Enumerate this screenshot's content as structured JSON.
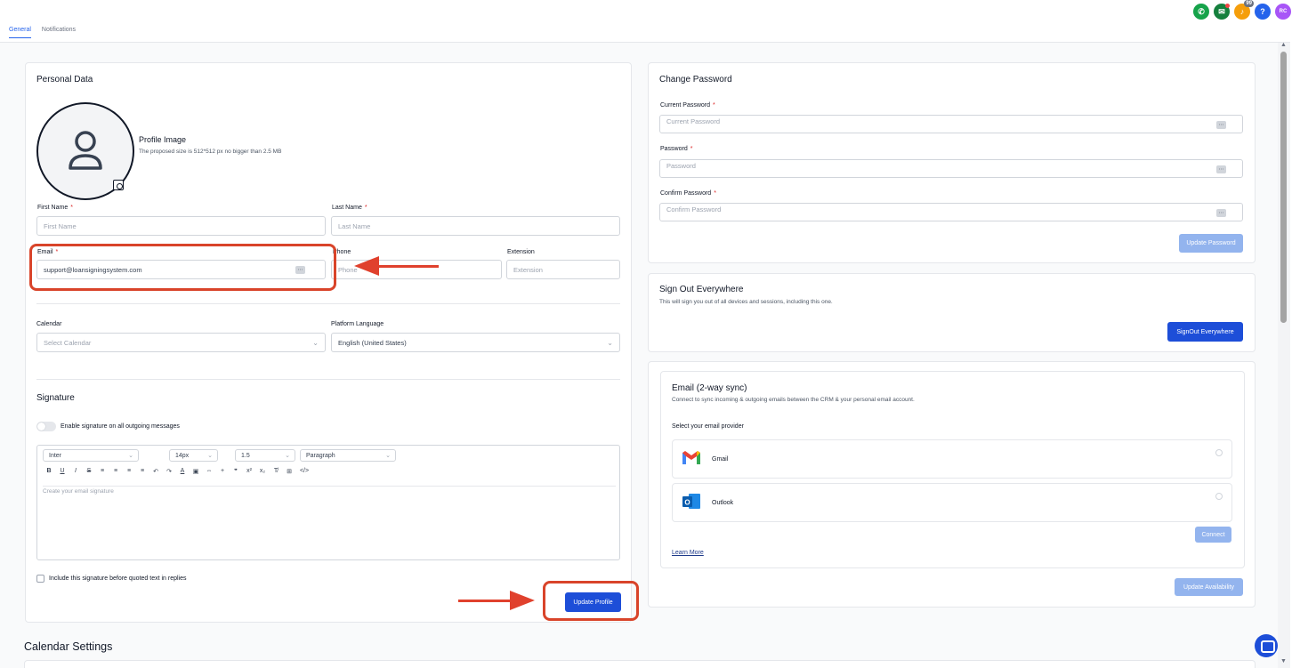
{
  "topbar": {
    "icons": [
      {
        "name": "phone-icon",
        "color": "#16a34a",
        "glyph": "✆"
      },
      {
        "name": "megaphone-icon",
        "color": "#15803d",
        "glyph": "✉"
      },
      {
        "name": "notification-bell-icon",
        "color": "#f59e0b",
        "glyph": "♪",
        "badge": "99"
      },
      {
        "name": "help-icon",
        "color": "#2563eb",
        "glyph": "?"
      },
      {
        "name": "user-avatar",
        "color": "#a855f7",
        "glyph": "RC"
      }
    ]
  },
  "tabs": [
    {
      "label": "General",
      "active": true
    },
    {
      "label": "Notifications",
      "active": false
    }
  ],
  "personal": {
    "title": "Personal Data",
    "profile_image_label": "Profile Image",
    "profile_image_hint": "The proposed size is 512*512 px no bigger than 2.5 MB",
    "first_name_label": "First Name",
    "first_name_placeholder": "First Name",
    "last_name_label": "Last Name",
    "last_name_placeholder": "Last Name",
    "email_label": "Email",
    "email_value": "support@loansigningsystem.com",
    "phone_label": "Phone",
    "phone_placeholder": "Phone",
    "extension_label": "Extension",
    "extension_placeholder": "Extension",
    "calendar_label": "Calendar",
    "calendar_placeholder": "Select Calendar",
    "language_label": "Platform Language",
    "language_value": "English (United States)",
    "required_mark": "*"
  },
  "signature": {
    "title": "Signature",
    "toggle_label": "Enable signature on all outgoing messages",
    "font": "Inter",
    "size": "14px",
    "line_height": "1.5",
    "block": "Paragraph",
    "toolbar": [
      "B",
      "U",
      "I",
      "S",
      "≡",
      "≡",
      "≡",
      "≡",
      "↶",
      "↷",
      "A",
      "▣",
      "⇔",
      "+",
      "❞",
      "x²",
      "x₂",
      "T̸",
      "⊞",
      "</>"
    ],
    "editor_placeholder": "Create your email signature",
    "include_label": "Include this signature before quoted text in replies",
    "update_button": "Update Profile"
  },
  "password": {
    "title": "Change Password",
    "current_label": "Current Password",
    "current_placeholder": "Current Password",
    "new_label": "Password",
    "new_placeholder": "Password",
    "confirm_label": "Confirm Password",
    "confirm_placeholder": "Confirm Password",
    "update_button": "Update Password"
  },
  "signout": {
    "title": "Sign Out Everywhere",
    "description": "This will sign you out of all devices and sessions, including this one.",
    "button": "SignOut Everywhere"
  },
  "email_sync": {
    "title": "Email (2-way sync)",
    "description": "Connect to sync incoming & outgoing emails between the CRM & your personal email account.",
    "select_label": "Select your email provider",
    "providers": [
      {
        "name": "Gmail",
        "icon": "gmail-icon"
      },
      {
        "name": "Outlook",
        "icon": "outlook-icon"
      }
    ],
    "connect_button": "Connect",
    "learn_more": "Learn More",
    "update_availability": "Update Availability"
  },
  "calendar_settings": {
    "title": "Calendar Settings"
  },
  "colors": {
    "primary": "#1d4ed8",
    "disabled": "#93b4ee",
    "highlight": "#d9442a",
    "required": "#dc2626"
  }
}
